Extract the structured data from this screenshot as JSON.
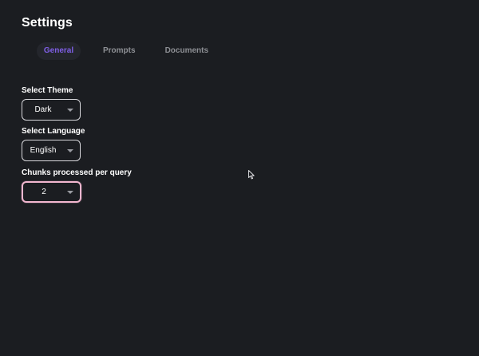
{
  "page": {
    "title": "Settings"
  },
  "tabs": [
    {
      "label": "General",
      "active": true
    },
    {
      "label": "Prompts",
      "active": false
    },
    {
      "label": "Documents",
      "active": false
    }
  ],
  "fields": {
    "theme": {
      "label": "Select Theme",
      "value": "Dark"
    },
    "language": {
      "label": "Select Language",
      "value": "English"
    },
    "chunks": {
      "label": "Chunks processed per query",
      "value": "2"
    }
  },
  "colors": {
    "background": "#1b1d21",
    "accent": "#7f5fe6",
    "focus_border": "#f2b6cf",
    "inactive_tab": "#8d8f94"
  },
  "icons": {
    "dropdown": "chevron-down-icon",
    "cursor": "mouse-pointer-icon"
  }
}
